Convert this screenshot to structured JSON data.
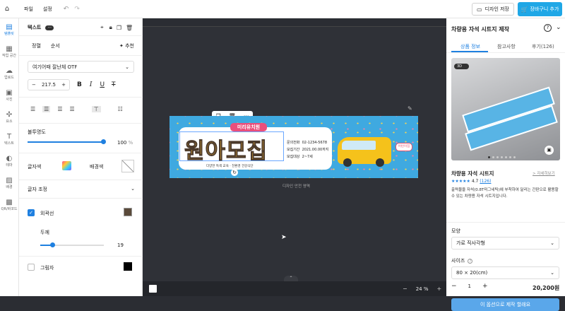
{
  "topbar": {
    "home_icon": "home-icon",
    "menu_file": "파일",
    "menu_settings": "설정",
    "save_label": "디자인 저장",
    "cart_label": "장바구니 추가"
  },
  "rail": {
    "items": [
      {
        "label": "템플릿",
        "icon": "▤"
      },
      {
        "label": "작업 공간",
        "icon": "▦"
      },
      {
        "label": "업로드",
        "icon": "☁"
      },
      {
        "label": "사진",
        "icon": "▣"
      },
      {
        "label": "요소",
        "icon": "✣"
      },
      {
        "label": "텍스트",
        "icon": "T"
      },
      {
        "label": "테마",
        "icon": "◐"
      },
      {
        "label": "배경",
        "icon": "▨"
      },
      {
        "label": "QR/바코드",
        "icon": "▩"
      }
    ]
  },
  "panel": {
    "header": "텍스트",
    "more": "···",
    "tab_align": "정렬",
    "tab_order": "순서",
    "recommend": "추천",
    "font_name": "여기어때 잘난체 OTF",
    "font_size": "217.5",
    "opacity_label": "불투명도",
    "opacity_value": "100",
    "opacity_unit": "%",
    "opacity_level": 1.0,
    "text_color_label": "글자색",
    "bg_color_label": "배경색",
    "text_adjust_label": "글자 조정",
    "outline_label": "외곽선",
    "thickness_label": "두께",
    "thickness_value": "19",
    "thickness_level": 0.19,
    "shadow_label": "그림자"
  },
  "canvas": {
    "safe_area": "디자인 안전 영역",
    "zoom": "24",
    "zoom_unit": "%",
    "zoom_minus": "−",
    "zoom_plus": "+",
    "banner": {
      "top_label": "미리유치원",
      "title": "원아모집",
      "subtitle": "다양한 특색 교육 · 친환경 건강식단",
      "info1_label": "문의전화",
      "info1_value": "02-1234-5678",
      "info2_label": "모집기간",
      "info2_value": "2021.00.00까지",
      "info3_label": "모집대상",
      "info3_value": "2~7세",
      "bus_label": "어린이집"
    }
  },
  "right": {
    "title": "차량용 자석 시트지 제작",
    "tabs": [
      "상품 정보",
      "참고사항",
      "후기(126)"
    ],
    "badge_3d": "3D",
    "product_name": "차량용 자석 시트지",
    "detail_link": "> 자세히보기",
    "stars": "★★★★★",
    "rating": "4.7",
    "reviews": "(126)",
    "description": "출력물을 자석(0.8T미그네틱)에 부착하여 달리는 간판으로 활용할 수 있는 차량용 자석 시트지입니다.",
    "shape_label": "모양",
    "shape_value": "가로 직사각형",
    "size_label": "사이즈",
    "size_value": "80 × 20(cm)",
    "qty": "1",
    "price": "20,200원",
    "order_button": "이 옵션으로 제작 할래요"
  },
  "colors": {
    "accent": "#1fa7e6",
    "primary": "#1f80e0",
    "banner_bg": "#3fa9e0",
    "bus": "#f5c21b"
  }
}
